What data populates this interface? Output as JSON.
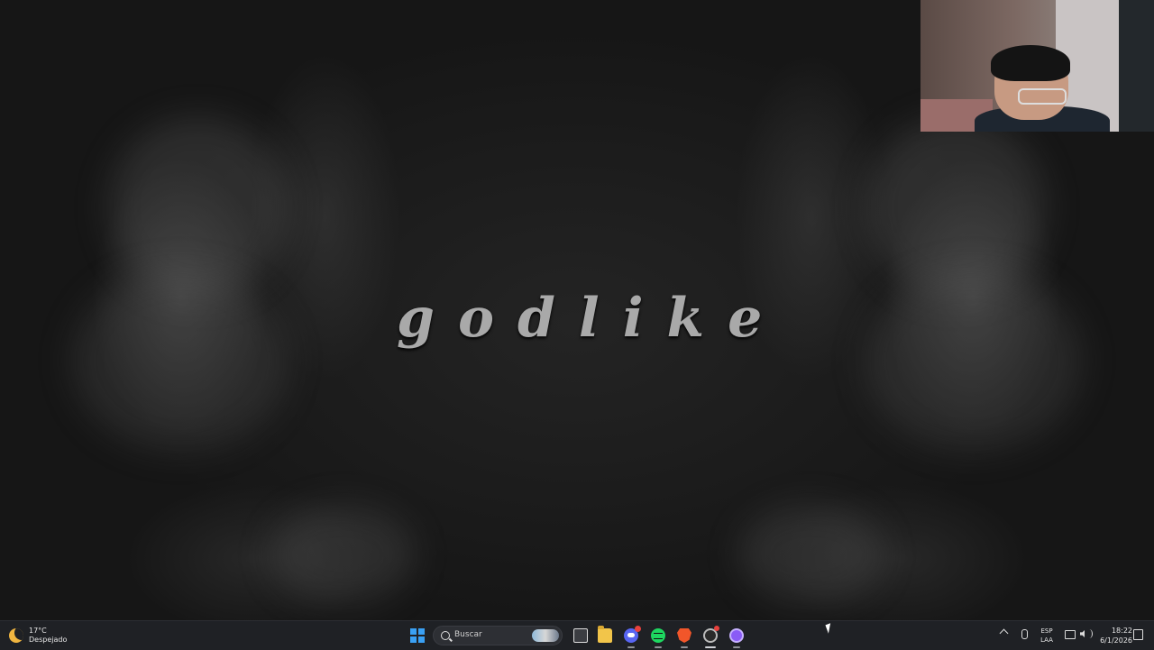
{
  "wallpaper": {
    "title": "godlike"
  },
  "taskbar": {
    "weather": {
      "temperature": "17°C",
      "condition": "Despejado",
      "icon": "moon-icon"
    },
    "search": {
      "placeholder": "Buscar"
    },
    "apps": [
      "start-icon",
      "task-view-icon",
      "file-explorer-icon",
      "discord-icon",
      "spotify-icon",
      "brave-icon",
      "obs-icon",
      "twitch-icon"
    ],
    "tray": {
      "lang_top": "ESP",
      "lang_bottom": "LAA",
      "time": "18:22",
      "date": "6/1/2026"
    }
  },
  "colors": {
    "accent": "#3aa0f3",
    "taskbar": "#1f2125"
  }
}
